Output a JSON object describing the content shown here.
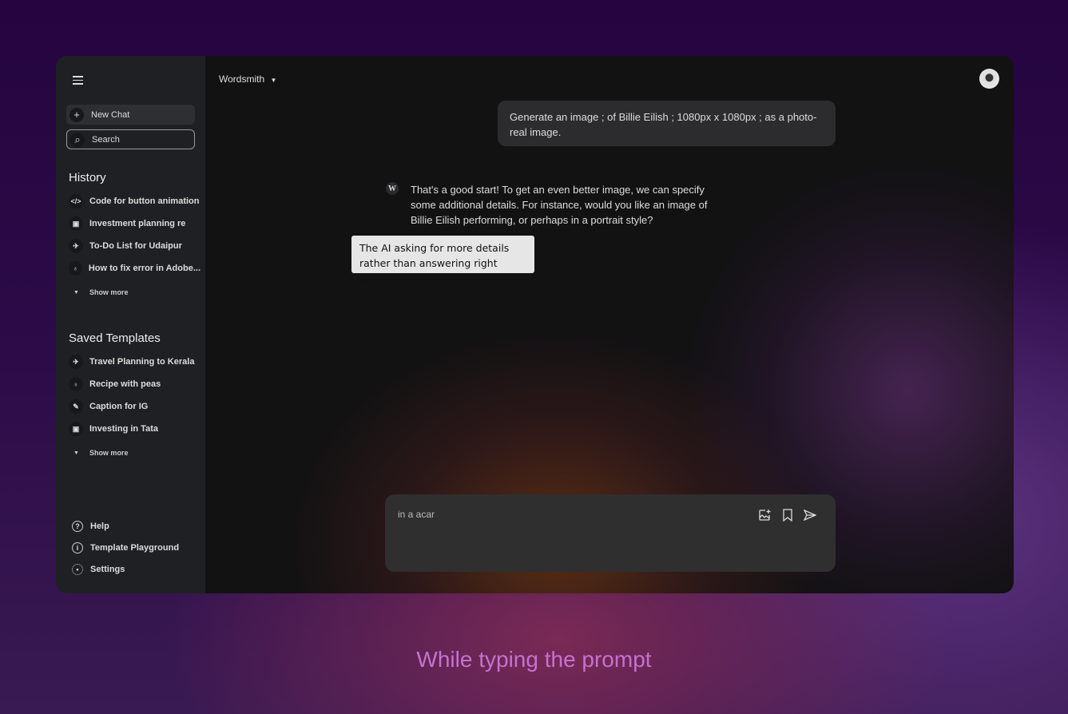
{
  "sidebar": {
    "new_chat": "New Chat",
    "search_placeholder": "Search",
    "history_title": "History",
    "history": [
      {
        "label": "Code for button animation",
        "icon": "code-icon"
      },
      {
        "label": "Investment planning re",
        "icon": "chart-icon"
      },
      {
        "label": "To-Do List for Udaipur",
        "icon": "plane-icon"
      },
      {
        "label": "How to fix error in Adobe...",
        "icon": "bulb-icon"
      }
    ],
    "show_more": "Show more",
    "templates_title": "Saved Templates",
    "templates": [
      {
        "label": "Travel Planning to Kerala",
        "icon": "plane-icon"
      },
      {
        "label": "Recipe with peas",
        "icon": "bulb-icon"
      },
      {
        "label": "Caption for IG",
        "icon": "pencil-icon"
      },
      {
        "label": "Investing in Tata",
        "icon": "chart-icon"
      }
    ],
    "footer": [
      {
        "label": "Help"
      },
      {
        "label": "Template Playground"
      },
      {
        "label": "Settings"
      }
    ]
  },
  "header": {
    "model": "Wordsmith"
  },
  "chat": {
    "user_message": "Generate an image ; of Billie Eilish ; 1080px x 1080px ; as a photo-real image.",
    "ai_logo": "W",
    "ai_message": "That's a good start! To get an even better image, we can specify some additional details.  For instance, would you like an image of Billie Eilish performing, or perhaps in a portrait style?"
  },
  "annotation": "The AI asking for more details rather than answering right away",
  "composer": {
    "value": "in a acar"
  },
  "caption": "While typing the prompt"
}
